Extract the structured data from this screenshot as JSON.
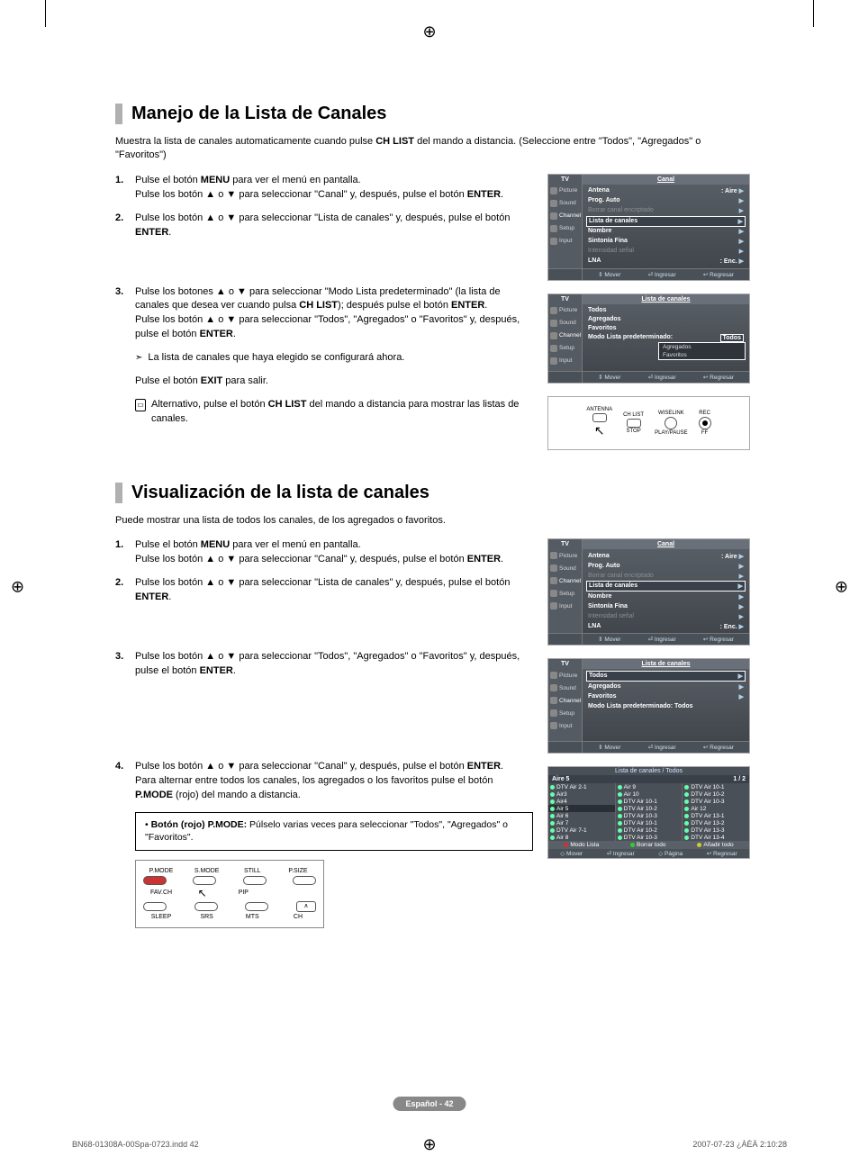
{
  "page": {
    "footer_label": "Español - 42",
    "doc_left": "BN68-01308A-00Spa-0723.indd   42",
    "doc_right": "2007-07-23   ¿ÀÈÄ 2:10:28"
  },
  "section1": {
    "title": "Manejo de la Lista de Canales",
    "intro": "Muestra la lista de canales automaticamente cuando pulse CH LIST del mando a distancia. (Seleccione entre \"Todos\", \"Agregados\" o \"Favoritos\")",
    "steps": {
      "s1a": "Pulse el botón ",
      "s1b": " para ver el menú en pantalla.",
      "s1c": "Pulse los botón ▲ o ▼ para seleccionar \"Canal\" y, después, pulse el botón ",
      "s2a": "Pulse los botón ▲ o ▼ para seleccionar \"Lista de canales\" y, después, pulse el botón ",
      "s3a": "Pulse los botones ▲ o ▼ para seleccionar \"Modo Lista predeterminado\" (la lista de canales que desea ver cuando pulsa ",
      "s3b": "); después pulse el botón ",
      "s3c": "Pulse los botón ▲ o ▼ para seleccionar \"Todos\", \"Agregados\" o \"Favoritos\" y, después, pulse el botón ",
      "note": "La lista de canales que haya elegido se configurará ahora.",
      "exit": "Pulse el botón ",
      "exit2": " para salir.",
      "alt": "Alternativo, pulse el botón ",
      "alt2": " del mando a distancia para mostrar las listas de canales."
    },
    "bold": {
      "menu": "MENU",
      "enter": "ENTER",
      "chlist": "CH LIST",
      "exit": "EXIT"
    }
  },
  "section2": {
    "title": "Visualización de la lista de canales",
    "intro": "Puede mostrar una lista de todos los canales, de los agregados o favoritos.",
    "steps": {
      "s1a": "Pulse el botón ",
      "s1b": " para ver el menú en pantalla.",
      "s1c": "Pulse los botón ▲ o ▼ para seleccionar \"Canal\" y, después, pulse el botón ",
      "s2a": "Pulse los botón ▲ o ▼ para seleccionar \"Lista de canales\" y, después, pulse el botón ",
      "s3a": "Pulse los botón ▲ o ▼ para seleccionar \"Todos\", \"Agregados\" o \"Favoritos\" y, después, pulse el botón ",
      "s4a": "Pulse los botón ▲ o ▼ para seleccionar \"Canal\" y, después, pulse el botón ",
      "s4b": "Para alternar entre todos los canales, los agregados o los favoritos pulse el botón ",
      "s4c": " (rojo) del mando a distancia."
    },
    "tip_label": "Botón (rojo) P.MODE:",
    "tip_text": " Púlselo varias veces para seleccionar \"Todos\", \"Agregados\" o \"Favoritos\".",
    "bold": {
      "menu": "MENU",
      "enter": "ENTER",
      "pmode": "P.MODE"
    }
  },
  "osd1": {
    "tv": "TV",
    "title": "Canal",
    "side": [
      "Picture",
      "Sound",
      "Channel",
      "Setup",
      "Input"
    ],
    "rows": [
      {
        "l": "Antena",
        "r": ": Aire",
        "c": "bold"
      },
      {
        "l": "Prog. Auto",
        "r": "",
        "c": "bold"
      },
      {
        "l": "Borrar canal encriptado",
        "r": "",
        "c": "dim"
      },
      {
        "l": "Lista de canales",
        "r": "",
        "c": "sel"
      },
      {
        "l": "Nombre",
        "r": "",
        "c": "bold"
      },
      {
        "l": "Sintonía Fina",
        "r": "",
        "c": "bold"
      },
      {
        "l": "Intensidad señal",
        "r": "",
        "c": "dim"
      },
      {
        "l": "LNA",
        "r": ": Enc.",
        "c": "bold"
      }
    ],
    "footer": [
      "⇕ Mover",
      "⏎ Ingresar",
      "↩ Regresar"
    ]
  },
  "osd2": {
    "tv": "TV",
    "title": "Lista de canales",
    "side": [
      "Picture",
      "Sound",
      "Channel",
      "Setup",
      "Input"
    ],
    "rows": [
      {
        "l": "Todos",
        "r": "",
        "c": "bold"
      },
      {
        "l": "Agregados",
        "r": "",
        "c": "bold"
      },
      {
        "l": "Favoritos",
        "r": "",
        "c": "bold"
      },
      {
        "l": "Modo Lista predeterminado:",
        "r": "",
        "c": "bold"
      }
    ],
    "submenu_first": "Todos",
    "submenu": [
      "Agregados",
      "Favoritos"
    ],
    "footer": [
      "⇕ Mover",
      "⏎ Ingresar",
      "↩ Regresar"
    ]
  },
  "remote1": {
    "labels": [
      "ANTENNA",
      "CH LIST",
      "WISELINK",
      "REC"
    ],
    "labels2": [
      "STOP",
      "PLAY/PAUSE",
      "FF"
    ]
  },
  "osd3": {
    "tv": "TV",
    "title": "Canal",
    "rows": [
      {
        "l": "Antena",
        "r": ": Aire",
        "c": "bold"
      },
      {
        "l": "Prog. Auto",
        "r": "",
        "c": "bold"
      },
      {
        "l": "Borrar canal encriptado",
        "r": "",
        "c": "dim"
      },
      {
        "l": "Lista de canales",
        "r": "",
        "c": "sel"
      },
      {
        "l": "Nombre",
        "r": "",
        "c": "bold"
      },
      {
        "l": "Sintonía Fina",
        "r": "",
        "c": "bold"
      },
      {
        "l": "Intensidad señal",
        "r": "",
        "c": "dim"
      },
      {
        "l": "LNA",
        "r": ": Enc.",
        "c": "bold"
      }
    ],
    "footer": [
      "⇕ Mover",
      "⏎ Ingresar",
      "↩ Regresar"
    ]
  },
  "osd4": {
    "tv": "TV",
    "title": "Lista de canales",
    "rows": [
      {
        "l": "Todos",
        "r": "",
        "c": "sel"
      },
      {
        "l": "Agregados",
        "r": "",
        "c": "bold"
      },
      {
        "l": "Favoritos",
        "r": "",
        "c": "bold"
      },
      {
        "l": "Modo Lista predeterminado: Todos",
        "r": "▶",
        "c": "bold"
      }
    ],
    "footer": [
      "⇕ Mover",
      "⏎ Ingresar",
      "↩ Regresar"
    ]
  },
  "clist": {
    "title": "Lista de canales / Todos",
    "current": "Aire 5",
    "page": "1 / 2",
    "col1": [
      "DTV Air 2-1",
      "Air3",
      "Air4",
      "Air 5",
      "Air 6",
      "Air 7",
      "DTV Air 7-1",
      "Air 8"
    ],
    "col2": [
      "Air 9",
      "Air 10",
      "DTV Air 10-1",
      "DTV Air 10-2",
      "DTV Air 10-3",
      "DTV Air 10-1",
      "DTV Air 10-2",
      "DTV Air 10-3"
    ],
    "col3": [
      "DTV Air 10-1",
      "DTV Air 10-2",
      "DTV Air 10-3",
      "Air 12",
      "DTV Air 13-1",
      "DTV Air 13-2",
      "DTV Air 13-3",
      "DTV Air 13-4"
    ],
    "footer1": [
      {
        "c": "#c33",
        "t": "Modo Lista"
      },
      {
        "c": "#3c3",
        "t": "Borrar todo"
      },
      {
        "c": "#cc3",
        "t": "Añadir todo"
      }
    ],
    "footer2": [
      "◇ Mover",
      "⏎ Ingresar",
      "◇ Página",
      "↩ Regresar"
    ]
  },
  "remote2": {
    "row1": [
      "P.MODE",
      "S.MODE",
      "STILL",
      "P.SIZE"
    ],
    "row2": [
      "FAV.CH",
      "",
      "PIP",
      ""
    ],
    "row3": [
      "SLEEP",
      "SRS",
      "MTS",
      "CH"
    ]
  }
}
